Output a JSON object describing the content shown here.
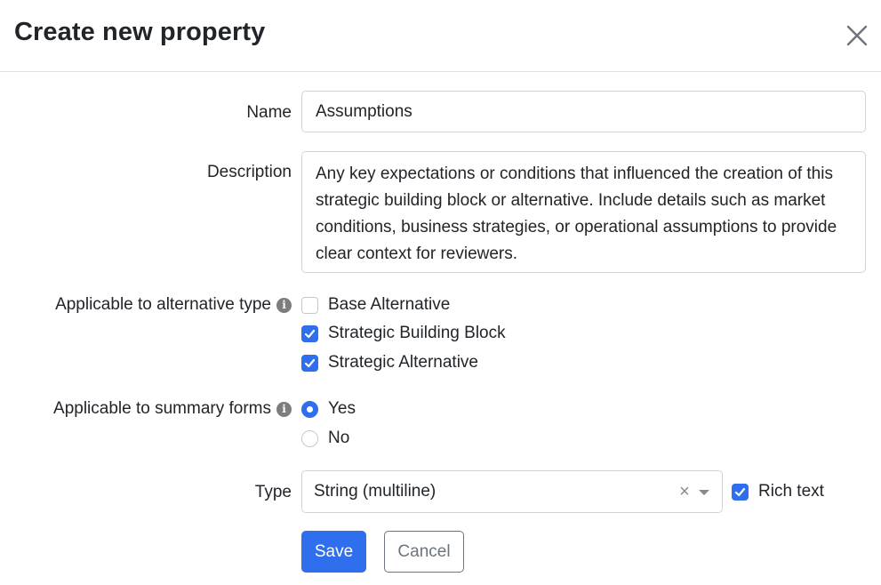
{
  "dialog": {
    "title": "Create new property",
    "close_icon": "close-icon"
  },
  "form": {
    "name": {
      "label": "Name",
      "value": "Assumptions"
    },
    "description": {
      "label": "Description",
      "value": "Any key expectations or conditions that influenced the creation of this strategic building block or alternative. Include details such as market conditions, business strategies, or operational assumptions to provide clear context for reviewers."
    },
    "alternative_type": {
      "label": "Applicable to alternative type",
      "info_icon": "info-icon",
      "options": [
        {
          "label": "Base Alternative",
          "checked": false
        },
        {
          "label": "Strategic Building Block",
          "checked": true
        },
        {
          "label": "Strategic Alternative",
          "checked": true
        }
      ]
    },
    "summary_forms": {
      "label": "Applicable to summary forms",
      "info_icon": "info-icon",
      "options": [
        {
          "label": "Yes",
          "selected": true
        },
        {
          "label": "No",
          "selected": false
        }
      ]
    },
    "type": {
      "label": "Type",
      "value": "String (multiline)",
      "clear_glyph": "×",
      "rich_text": {
        "label": "Rich text",
        "checked": true
      }
    }
  },
  "buttons": {
    "save": "Save",
    "cancel": "Cancel"
  },
  "colors": {
    "accent": "#2f6fed",
    "border": "#ced4da",
    "text": "#212529",
    "muted": "#6c757d"
  }
}
